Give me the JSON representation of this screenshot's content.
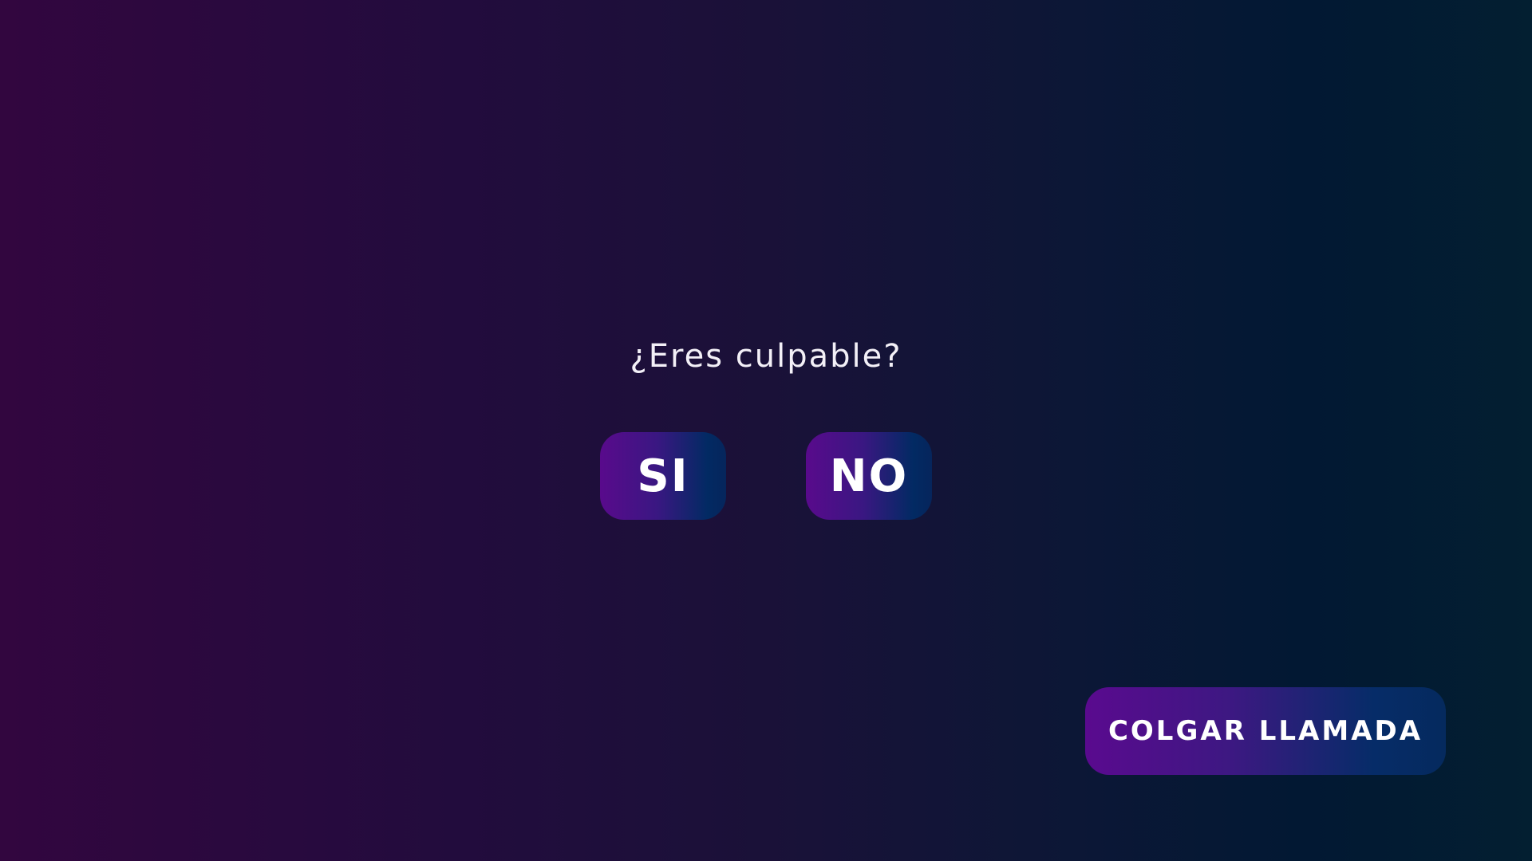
{
  "question": {
    "text": "¿Eres culpable?"
  },
  "answers": {
    "yes_label": "SI",
    "no_label": "NO"
  },
  "call": {
    "hangup_label": "COLGAR LLAMADA"
  },
  "colors": {
    "background_left": "#32063f",
    "background_right": "#031f31",
    "button_purple": "#590a8c",
    "button_blue": "#022a63",
    "text": "#ffffff"
  }
}
